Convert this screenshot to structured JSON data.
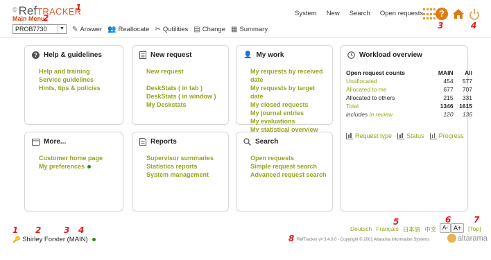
{
  "app": {
    "logo_ref": "Ref",
    "logo_tracker": "TRACKER",
    "main_menu": "Main Menu"
  },
  "annotations": {
    "a1": "1",
    "a2": "2",
    "a3": "3",
    "a4": "4",
    "a5": "5",
    "a6": "6",
    "a7": "7",
    "a8": "8",
    "b1": "1",
    "b2": "2",
    "b3": "3",
    "b4": "4"
  },
  "top_nav": {
    "system": "System",
    "new": "New",
    "search": "Search",
    "open_requests": "Open requests"
  },
  "icons": {
    "help_glyph": "?",
    "colors": {
      "accent": "#e07a14",
      "link": "#98a21c",
      "status_green": "#2e8b1b",
      "title_orange": "#e05a2a"
    }
  },
  "toolbar": {
    "request_id": "PROB7730",
    "answer": "Answer",
    "reallocate": "Reallocate",
    "qutilities": "Qutilities",
    "change": "Change",
    "summary": "Summary"
  },
  "panels": {
    "help": {
      "title": "Help & guidelines",
      "links": [
        "Help and training",
        "Service guidelines",
        "Hints, tips & policies"
      ]
    },
    "new_request": {
      "title": "New request",
      "link_new": "New request",
      "link_tab": "DeskStats ( in tab )",
      "link_window": "DeskStats ( in window )",
      "link_my": "My Deskstats"
    },
    "my_work": {
      "title": "My work",
      "links": [
        "My requests by received date",
        "My requests by target date",
        "My closed requests",
        "My journal entries",
        "My evaluations",
        "My statistical overview"
      ]
    },
    "more": {
      "title": "More...",
      "link_customer": "Customer home page",
      "link_prefs": "My preferences"
    },
    "reports": {
      "title": "Reports",
      "links": [
        "Supervisor summaries",
        "Statistics reports",
        "System management"
      ]
    },
    "search": {
      "title": "Search",
      "links": [
        "Open requests",
        "Simple request search",
        "Advanced request search"
      ]
    },
    "workload": {
      "title": "Workload overview",
      "header": {
        "label": "Open request counts",
        "main": "MAIN",
        "all": "All"
      },
      "rows": [
        {
          "label": "Unallocated",
          "main": "454",
          "all": "577"
        },
        {
          "label": "Allocated to me",
          "main": "677",
          "all": "707"
        },
        {
          "label": "Allocated to others",
          "main": "215",
          "all": "331"
        },
        {
          "label": "Total",
          "main": "1346",
          "all": "1615"
        }
      ],
      "review": {
        "label_a": "includes",
        "label_b": "in review",
        "main": "120",
        "all": "136"
      },
      "links": {
        "request_type": "Request type",
        "status": "Status",
        "progress": "Progress"
      }
    }
  },
  "footer": {
    "langs": [
      "Deutsch",
      "Français",
      "日本語",
      "中文"
    ],
    "font_small": "A-",
    "font_large": "A+",
    "top": "[Top]",
    "user": "Shirley Forster (MAIN)",
    "copyright": "RefTracker v# 3.4.0.0 - Copyright © 2001 Altarama Information Systems",
    "brand": "altarama"
  }
}
